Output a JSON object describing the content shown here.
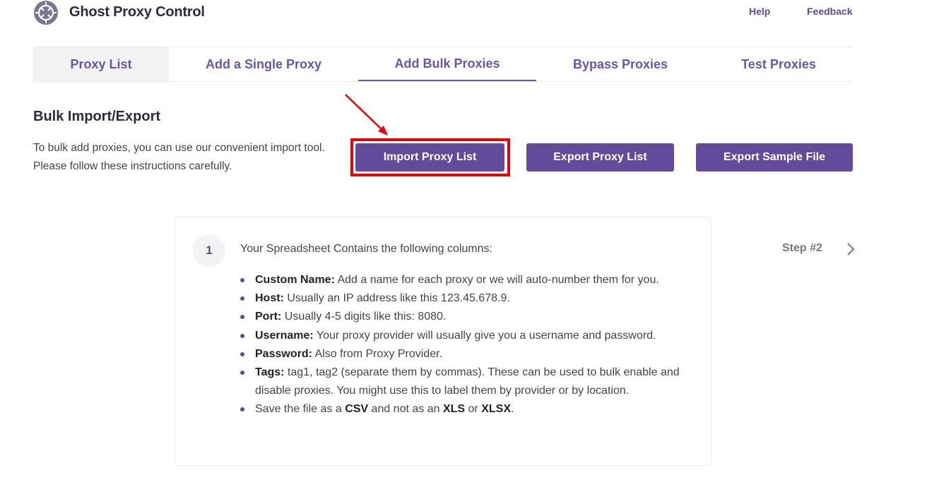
{
  "header": {
    "app_title": "Ghost Proxy Control",
    "help_label": "Help",
    "feedback_label": "Feedback"
  },
  "tabs": [
    {
      "label": "Proxy List"
    },
    {
      "label": "Add a Single Proxy"
    },
    {
      "label": "Add Bulk Proxies",
      "active": true
    },
    {
      "label": "Bypass Proxies"
    },
    {
      "label": "Test Proxies"
    }
  ],
  "section": {
    "title": "Bulk Import/Export",
    "description": "To bulk add proxies, you can use our convenient import tool. Please follow these instructions carefully."
  },
  "buttons": {
    "import_label": "Import Proxy List",
    "export_label": "Export Proxy List",
    "sample_label": "Export Sample File"
  },
  "step": {
    "number": "1",
    "intro": "Your Spreadsheet Contains the following columns:",
    "items": [
      {
        "term": "Custom Name:",
        "text": " Add a name for each proxy or we will auto-number them for you."
      },
      {
        "term": "Host:",
        "text": " Usually an IP address like this 123.45.678.9."
      },
      {
        "term": "Port:",
        "text": " Usually 4-5 digits like this: 8080."
      },
      {
        "term": "Username:",
        "text": " Your proxy provider will usually give you a username and password."
      },
      {
        "term": "Password:",
        "text": " Also from Proxy Provider."
      },
      {
        "term": "Tags:",
        "text": " tag1, tag2 (separate them by commas). These can be used to bulk enable and disable proxies. You might use this to label them by provider or by location."
      }
    ],
    "save_note": {
      "prefix": "Save the file as a ",
      "csv": "CSV",
      "middle": " and not as an ",
      "xls": "XLS",
      "or": " or ",
      "xlsx": "XLSX",
      "suffix": "."
    },
    "next_label": "Step #2"
  },
  "icons": {
    "logo": "ghost-proxy-logo-icon",
    "next": "chevron-right-icon",
    "annotation": "red-arrow-icon"
  },
  "colors": {
    "brand_purple": "#644a9b",
    "highlight_red": "#e8000a"
  }
}
